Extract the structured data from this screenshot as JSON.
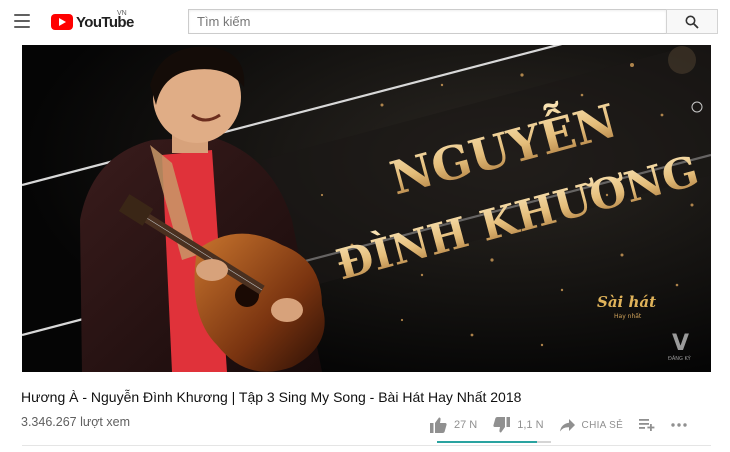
{
  "header": {
    "logo_text": "YouTube",
    "country_code": "VN",
    "search_placeholder": "Tìm kiếm"
  },
  "video": {
    "overlay_text_line1": "NGUYỄN",
    "overlay_text_line2": "ĐÌNH KHƯƠNG",
    "watermark_logo_line1": "Sài hát",
    "watermark_logo_line2": "Hay nhất",
    "channel_badge_letter": "V",
    "subscribe_label": "ĐĂNG KÝ"
  },
  "info": {
    "title": "Hương À - Nguyễn Đình Khương | Tập 3 Sing My Song - Bài Hát Hay Nhất 2018",
    "views": "3.346.267 lượt xem",
    "likes": "27 N",
    "dislikes": "1,1 N",
    "share_label": "CHIA SẺ",
    "like_ratio": 0.88
  },
  "colors": {
    "brand_red": "#ff0000",
    "sentiment_like": "#2aa3a0",
    "title_gold": "#e9c889"
  },
  "icons": [
    "menu-icon",
    "youtube-logo-icon",
    "search-icon",
    "thumbs-up-icon",
    "thumbs-down-icon",
    "share-icon",
    "add-to-playlist-icon",
    "more-icon"
  ]
}
